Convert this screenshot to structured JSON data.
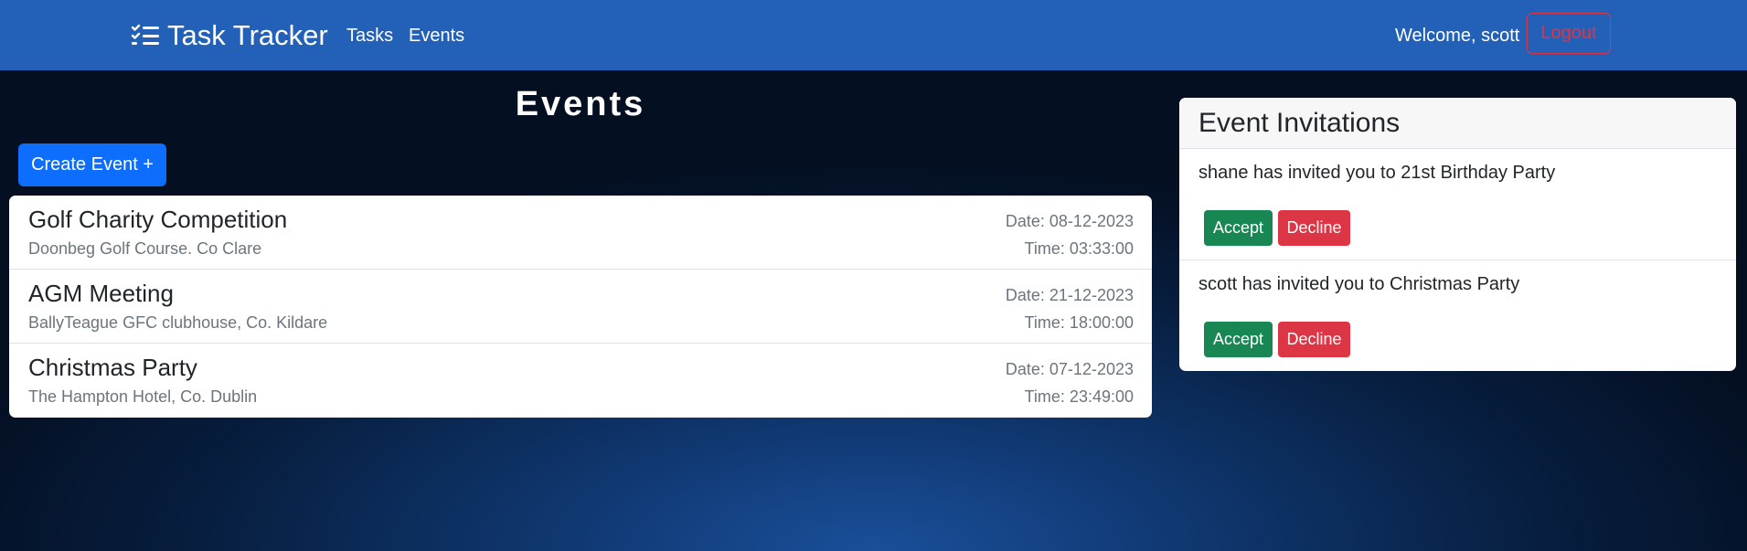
{
  "navbar": {
    "brand": "Task Tracker",
    "brand_icon": "checklist-icon",
    "links": [
      "Tasks",
      "Events"
    ],
    "welcome": "Welcome, scott",
    "logout": "Logout"
  },
  "page": {
    "title": "Events",
    "create_button": "Create Event +"
  },
  "events": [
    {
      "name": "Golf Charity Competition",
      "location": "Doonbeg Golf Course. Co Clare",
      "date": "Date: 08-12-2023",
      "time": "Time: 03:33:00"
    },
    {
      "name": "AGM Meeting",
      "location": "BallyTeague GFC clubhouse, Co. Kildare",
      "date": "Date: 21-12-2023",
      "time": "Time: 18:00:00"
    },
    {
      "name": "Christmas Party",
      "location": "The Hampton Hotel, Co. Dublin",
      "date": "Date: 07-12-2023",
      "time": "Time: 23:49:00"
    }
  ],
  "invitations": {
    "header": "Event Invitations",
    "items": [
      {
        "text": "shane has invited you to 21st Birthday Party",
        "accept": "Accept",
        "decline": "Decline"
      },
      {
        "text": "scott has invited you to Christmas Party",
        "accept": "Accept",
        "decline": "Decline"
      }
    ]
  },
  "colors": {
    "navbar": "#2360b8",
    "primary": "#0d6efd",
    "success": "#198754",
    "danger": "#dc3545"
  }
}
